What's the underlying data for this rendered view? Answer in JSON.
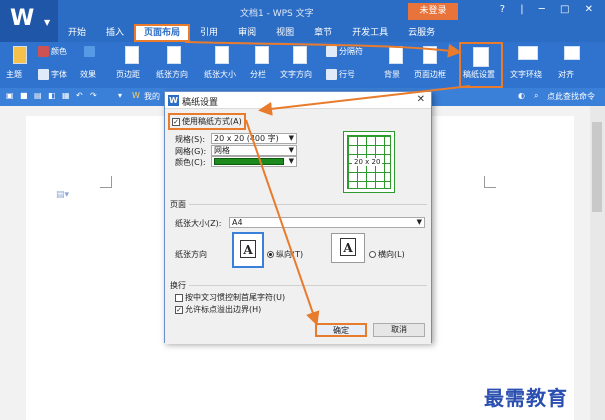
{
  "app": {
    "logo_letter": "W",
    "doc_title": "文档1 - WPS 文字",
    "login_label": "未登录",
    "window_controls": "? | ─ □ ✕"
  },
  "menu": {
    "items": [
      {
        "label": "开始"
      },
      {
        "label": "插入"
      },
      {
        "label": "页面布局",
        "active": true
      },
      {
        "label": "引用"
      },
      {
        "label": "审阅"
      },
      {
        "label": "视图"
      },
      {
        "label": "章节"
      },
      {
        "label": "开发工具"
      },
      {
        "label": "云服务"
      }
    ]
  },
  "ribbon": {
    "theme": "主题",
    "color": "颜色",
    "font": "字体",
    "effect": "效果",
    "margins": "页边距",
    "orientation": "纸张方向",
    "size": "纸张大小",
    "columns": "分栏",
    "text_direction": "文字方向",
    "line_numbers": "行号",
    "separator": "分隔符",
    "background": "背景",
    "border": "页面边框",
    "paper_setup": "稿纸设置",
    "text_wrap": "文字环绕",
    "align": "对齐"
  },
  "quickbar": {
    "search_label": "点此查找命令",
    "my_label": "我的"
  },
  "dialog": {
    "title": "稿纸设置",
    "close_icon": "close-icon",
    "use_paper_label": "使用稿纸方式(A)",
    "use_paper_checked": true,
    "spec_label": "规格(S):",
    "spec_value": "20 x 20 (400 字)",
    "grid_label": "网格(G):",
    "grid_value": "网格",
    "color_label": "颜色(C):",
    "color_value": "#1c8a1c",
    "preview_label": "20 x 20",
    "page_section": "页面",
    "paper_size_label": "纸张大小(Z):",
    "paper_size_value": "A4",
    "orientation_label": "纸张方向",
    "portrait_label": "纵向(T)",
    "landscape_label": "横向(L)",
    "portrait_selected": true,
    "wrap_section": "换行",
    "punct_rule_label": "按中文习惯控制首尾字符(U)",
    "punct_rule_checked": false,
    "allow_overflow_label": "允许标点溢出边界(H)",
    "allow_overflow_checked": true,
    "ok_label": "确定",
    "cancel_label": "取消"
  },
  "watermark": {
    "text": "最需教育"
  },
  "colors": {
    "title_blue": "#2b6cc4",
    "accent_orange": "#e87b2c",
    "grid_green": "#1c8a1c"
  }
}
